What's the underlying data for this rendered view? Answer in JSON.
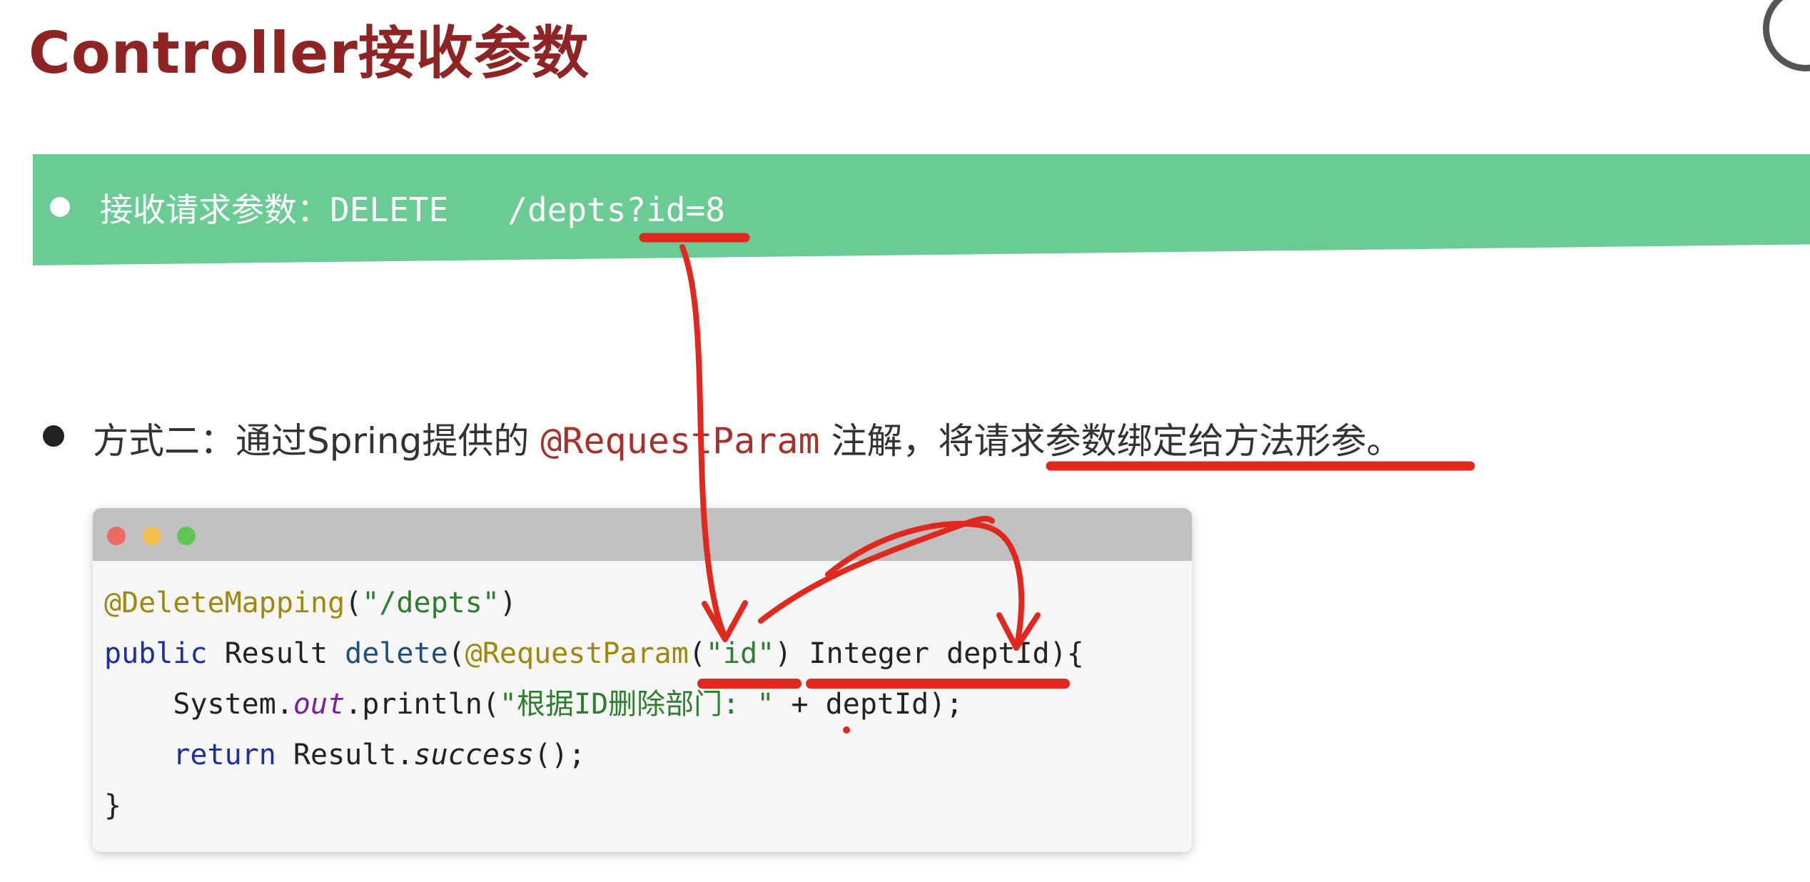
{
  "title": "Controller接收参数",
  "banner": {
    "text": "接收请求参数：DELETE   /depts?id=8"
  },
  "bullet2": {
    "prefix": "方式二：通过Spring提供的 ",
    "annotation": "@RequestParam",
    "middle": " 注解，将",
    "highlight": "请求参数绑定给方法形参",
    "suffix": "。"
  },
  "code": {
    "line1": {
      "ann": "@DeleteMapping",
      "p1": "(",
      "str": "\"/depts\"",
      "p2": ")"
    },
    "line2": {
      "kw": "public",
      "type": " Result ",
      "method": "delete",
      "p1": "(",
      "ann": "@RequestParam",
      "p2": "(",
      "str": "\"id\"",
      "rest": ") Integer deptId){"
    },
    "line3": {
      "indent": "    ",
      "obj": "System.",
      "field": "out",
      "call": ".println(",
      "str": "\"根据ID删除部门: \"",
      "rest": " + deptId);"
    },
    "line4": {
      "indent": "    ",
      "kw": "return",
      "obj": " Result.",
      "method": "success",
      "rest": "();"
    },
    "line5": "}"
  },
  "colors": {
    "title": "#8e2424",
    "banner": "#6bcb95",
    "annotation_marks": "#e0281e"
  }
}
